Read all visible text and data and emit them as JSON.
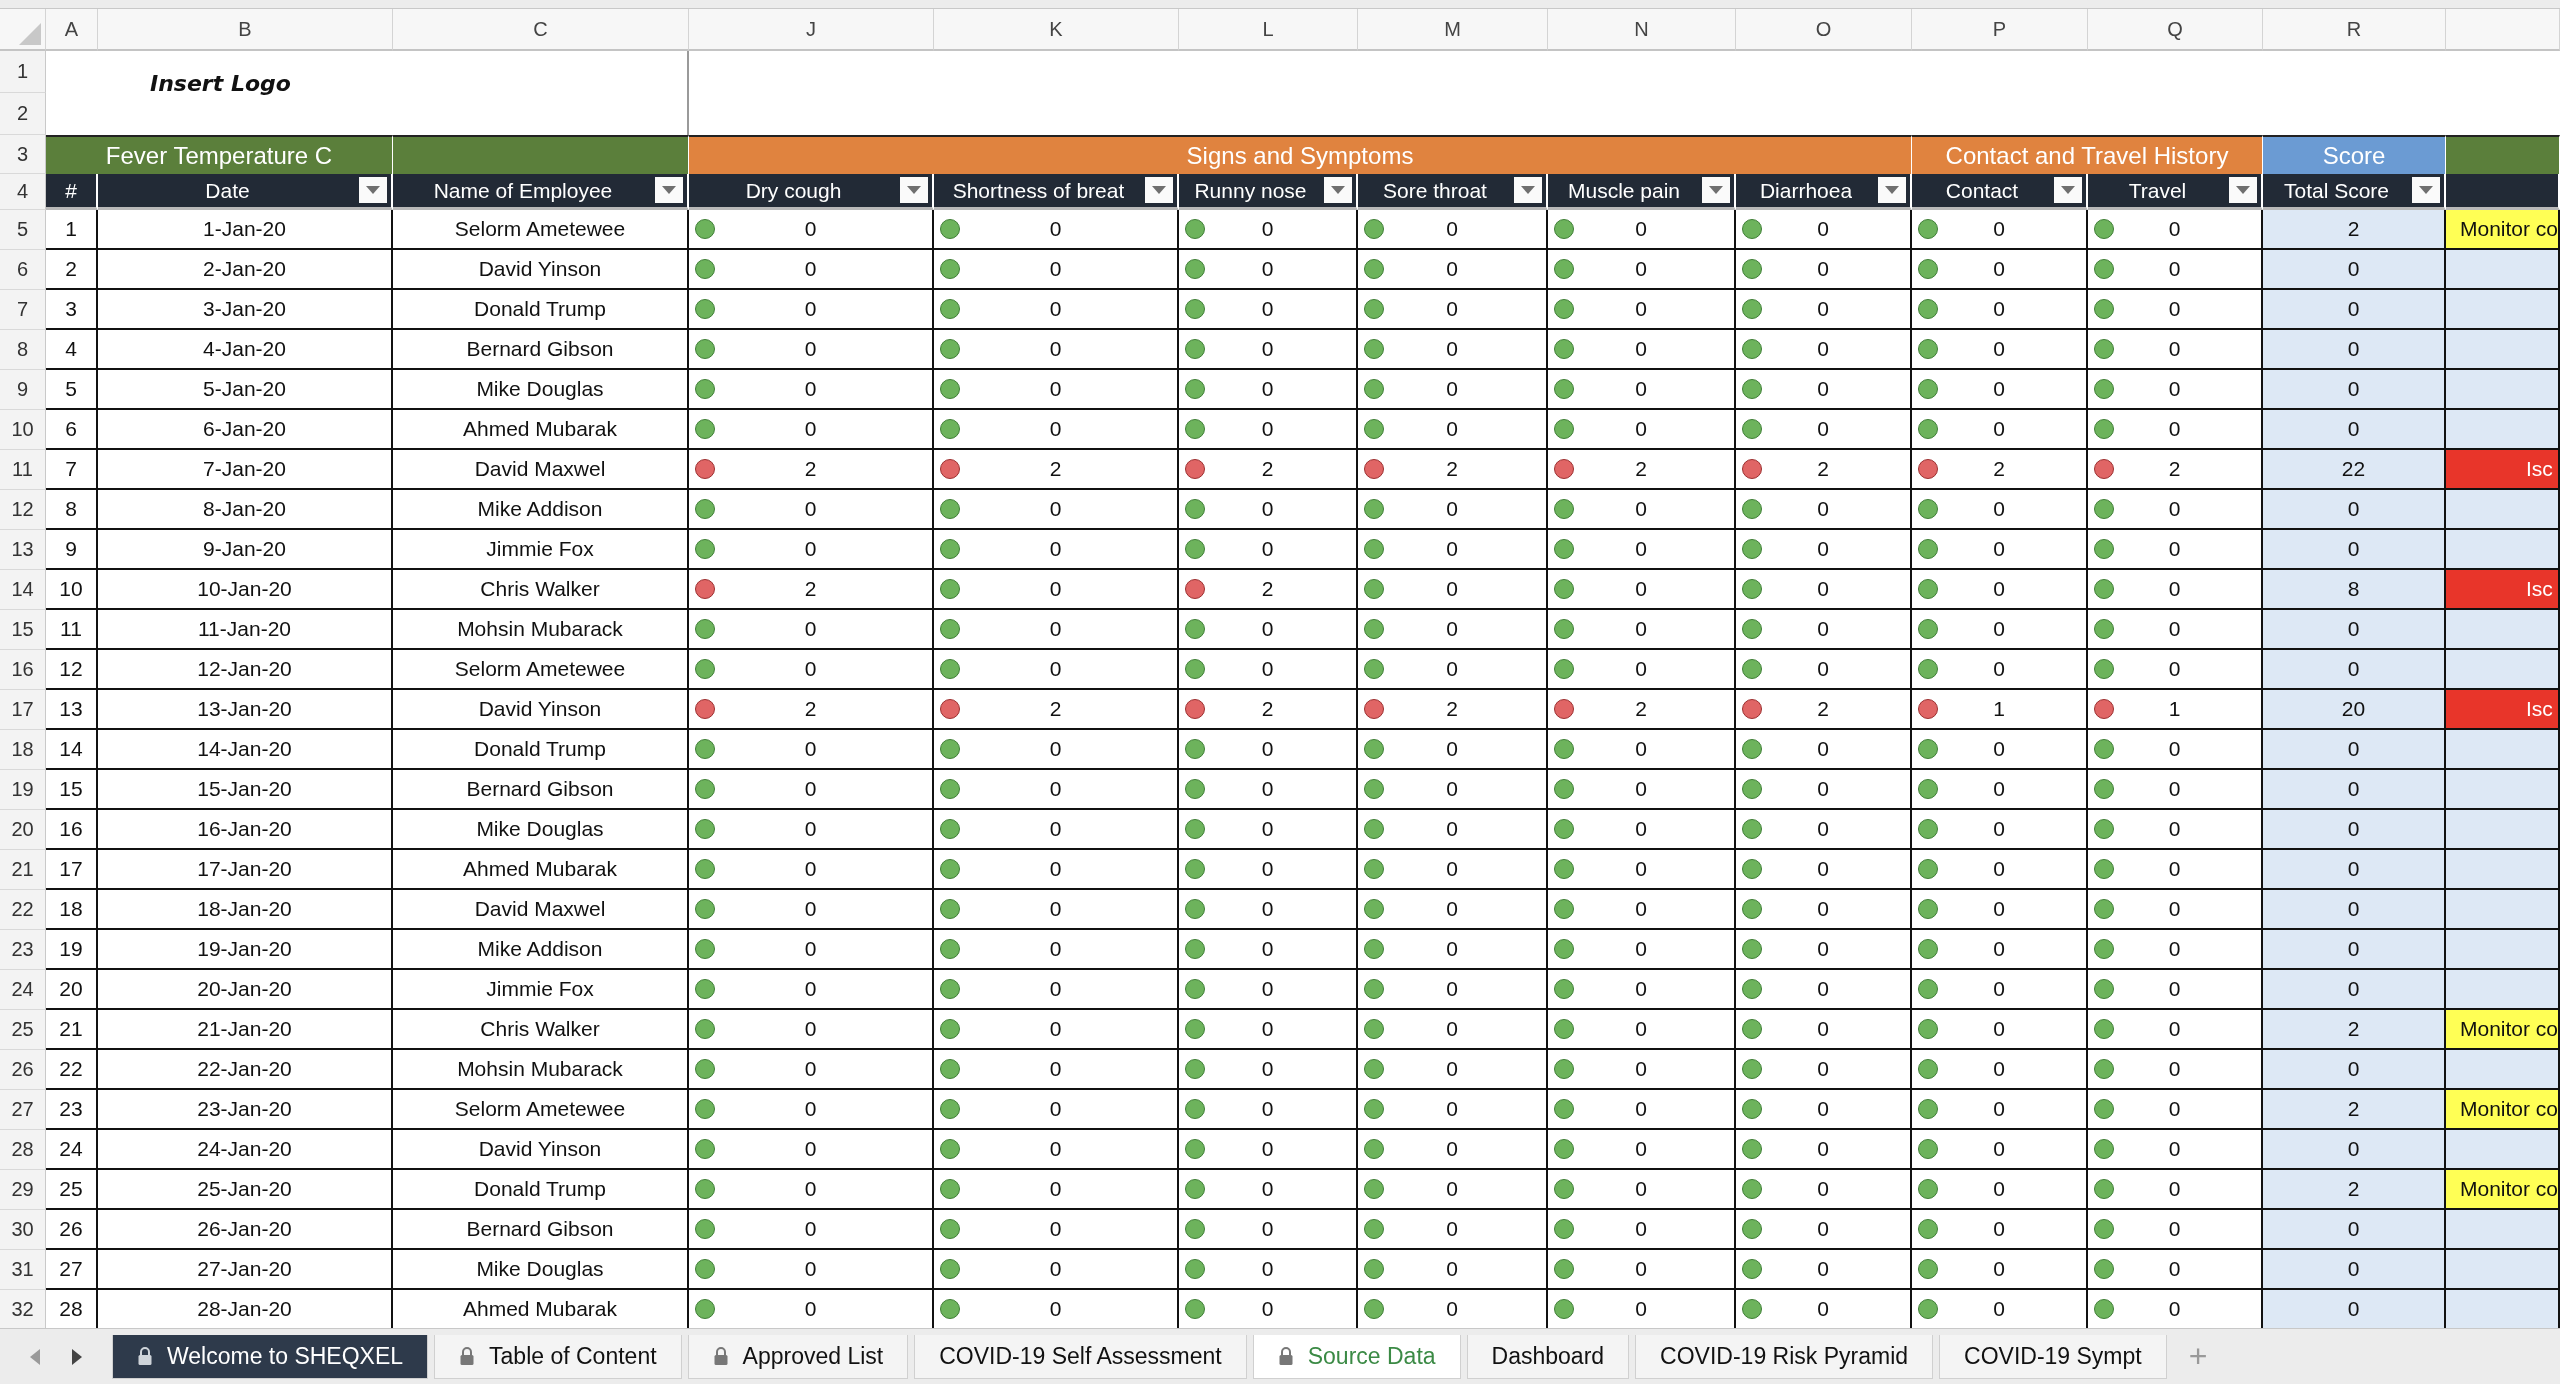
{
  "column_letters": [
    "A",
    "B",
    "C",
    "J",
    "K",
    "L",
    "M",
    "N",
    "O",
    "P",
    "Q",
    "R"
  ],
  "header_row_numbers": [
    "1",
    "2",
    "3",
    "4"
  ],
  "logo_text": "Insert Logo",
  "group_headers": [
    {
      "label": "Fever Temperature C",
      "color": "#5b7f3b"
    },
    {
      "color": "#5b7f3b"
    },
    {
      "label": "Signs and Symptoms",
      "color": "#e0833f"
    },
    {
      "label": "Contact and Travel History",
      "color": "#e0833f"
    },
    {
      "label": "Score",
      "color": "#6b9bd3"
    },
    {
      "color": "#5b7f3b"
    }
  ],
  "columns": [
    {
      "label": "#",
      "filter": false
    },
    {
      "label": "Date",
      "filter": true
    },
    {
      "label": "Name of Employee",
      "filter": true
    },
    {
      "label": "Dry cough",
      "filter": true
    },
    {
      "label": "Shortness of breat",
      "filter": true
    },
    {
      "label": "Runny nose",
      "filter": true
    },
    {
      "label": "Sore throat",
      "filter": true
    },
    {
      "label": "Muscle pain",
      "filter": true
    },
    {
      "label": "Diarrhoea",
      "filter": true
    },
    {
      "label": "Contact",
      "filter": true
    },
    {
      "label": "Travel",
      "filter": true
    },
    {
      "label": "Total Score",
      "filter": true
    }
  ],
  "rows": [
    {
      "row_number": "5",
      "number": "1",
      "date": "1-Jan-20",
      "name": "Selorm Ametewee",
      "symptoms": [
        "0",
        "0",
        "0",
        "0",
        "0",
        "0",
        "0",
        "0"
      ],
      "flags": [
        false,
        false,
        false,
        false,
        false,
        false,
        false,
        false
      ],
      "score": "2",
      "status": {
        "kind": "monitor",
        "text": "Monitor co"
      }
    },
    {
      "row_number": "6",
      "number": "2",
      "date": "2-Jan-20",
      "name": "David Yinson",
      "symptoms": [
        "0",
        "0",
        "0",
        "0",
        "0",
        "0",
        "0",
        "0"
      ],
      "flags": [
        false,
        false,
        false,
        false,
        false,
        false,
        false,
        false
      ],
      "score": "0"
    },
    {
      "row_number": "7",
      "number": "3",
      "date": "3-Jan-20",
      "name": "Donald Trump",
      "symptoms": [
        "0",
        "0",
        "0",
        "0",
        "0",
        "0",
        "0",
        "0"
      ],
      "flags": [
        false,
        false,
        false,
        false,
        false,
        false,
        false,
        false
      ],
      "score": "0"
    },
    {
      "row_number": "8",
      "number": "4",
      "date": "4-Jan-20",
      "name": "Bernard Gibson",
      "symptoms": [
        "0",
        "0",
        "0",
        "0",
        "0",
        "0",
        "0",
        "0"
      ],
      "flags": [
        false,
        false,
        false,
        false,
        false,
        false,
        false,
        false
      ],
      "score": "0"
    },
    {
      "row_number": "9",
      "number": "5",
      "date": "5-Jan-20",
      "name": "Mike Douglas",
      "symptoms": [
        "0",
        "0",
        "0",
        "0",
        "0",
        "0",
        "0",
        "0"
      ],
      "flags": [
        false,
        false,
        false,
        false,
        false,
        false,
        false,
        false
      ],
      "score": "0"
    },
    {
      "row_number": "10",
      "number": "6",
      "date": "6-Jan-20",
      "name": "Ahmed Mubarak",
      "symptoms": [
        "0",
        "0",
        "0",
        "0",
        "0",
        "0",
        "0",
        "0"
      ],
      "flags": [
        false,
        false,
        false,
        false,
        false,
        false,
        false,
        false
      ],
      "score": "0"
    },
    {
      "row_number": "11",
      "number": "7",
      "date": "7-Jan-20",
      "name": "David Maxwel",
      "symptoms": [
        "2",
        "2",
        "2",
        "2",
        "2",
        "2",
        "2",
        "2"
      ],
      "flags": [
        true,
        true,
        true,
        true,
        true,
        true,
        true,
        true
      ],
      "score": "22",
      "status": {
        "kind": "isolate",
        "text": "Isc"
      }
    },
    {
      "row_number": "12",
      "number": "8",
      "date": "8-Jan-20",
      "name": "Mike Addison",
      "symptoms": [
        "0",
        "0",
        "0",
        "0",
        "0",
        "0",
        "0",
        "0"
      ],
      "flags": [
        false,
        false,
        false,
        false,
        false,
        false,
        false,
        false
      ],
      "score": "0"
    },
    {
      "row_number": "13",
      "number": "9",
      "date": "9-Jan-20",
      "name": "Jimmie Fox",
      "symptoms": [
        "0",
        "0",
        "0",
        "0",
        "0",
        "0",
        "0",
        "0"
      ],
      "flags": [
        false,
        false,
        false,
        false,
        false,
        false,
        false,
        false
      ],
      "score": "0"
    },
    {
      "row_number": "14",
      "number": "10",
      "date": "10-Jan-20",
      "name": "Chris Walker",
      "symptoms": [
        "2",
        "0",
        "2",
        "0",
        "0",
        "0",
        "0",
        "0"
      ],
      "flags": [
        true,
        false,
        true,
        false,
        false,
        false,
        false,
        false
      ],
      "score": "8",
      "status": {
        "kind": "isolate",
        "text": "Isc"
      }
    },
    {
      "row_number": "15",
      "number": "11",
      "date": "11-Jan-20",
      "name": "Mohsin Mubarack",
      "symptoms": [
        "0",
        "0",
        "0",
        "0",
        "0",
        "0",
        "0",
        "0"
      ],
      "flags": [
        false,
        false,
        false,
        false,
        false,
        false,
        false,
        false
      ],
      "score": "0"
    },
    {
      "row_number": "16",
      "number": "12",
      "date": "12-Jan-20",
      "name": "Selorm Ametewee",
      "symptoms": [
        "0",
        "0",
        "0",
        "0",
        "0",
        "0",
        "0",
        "0"
      ],
      "flags": [
        false,
        false,
        false,
        false,
        false,
        false,
        false,
        false
      ],
      "score": "0"
    },
    {
      "row_number": "17",
      "number": "13",
      "date": "13-Jan-20",
      "name": "David Yinson",
      "symptoms": [
        "2",
        "2",
        "2",
        "2",
        "2",
        "2",
        "1",
        "1"
      ],
      "flags": [
        true,
        true,
        true,
        true,
        true,
        true,
        true,
        true
      ],
      "score": "20",
      "status": {
        "kind": "isolate",
        "text": "Isc"
      }
    },
    {
      "row_number": "18",
      "number": "14",
      "date": "14-Jan-20",
      "name": "Donald Trump",
      "symptoms": [
        "0",
        "0",
        "0",
        "0",
        "0",
        "0",
        "0",
        "0"
      ],
      "flags": [
        false,
        false,
        false,
        false,
        false,
        false,
        false,
        false
      ],
      "score": "0"
    },
    {
      "row_number": "19",
      "number": "15",
      "date": "15-Jan-20",
      "name": "Bernard Gibson",
      "symptoms": [
        "0",
        "0",
        "0",
        "0",
        "0",
        "0",
        "0",
        "0"
      ],
      "flags": [
        false,
        false,
        false,
        false,
        false,
        false,
        false,
        false
      ],
      "score": "0"
    },
    {
      "row_number": "20",
      "number": "16",
      "date": "16-Jan-20",
      "name": "Mike Douglas",
      "symptoms": [
        "0",
        "0",
        "0",
        "0",
        "0",
        "0",
        "0",
        "0"
      ],
      "flags": [
        false,
        false,
        false,
        false,
        false,
        false,
        false,
        false
      ],
      "score": "0"
    },
    {
      "row_number": "21",
      "number": "17",
      "date": "17-Jan-20",
      "name": "Ahmed Mubarak",
      "symptoms": [
        "0",
        "0",
        "0",
        "0",
        "0",
        "0",
        "0",
        "0"
      ],
      "flags": [
        false,
        false,
        false,
        false,
        false,
        false,
        false,
        false
      ],
      "score": "0"
    },
    {
      "row_number": "22",
      "number": "18",
      "date": "18-Jan-20",
      "name": "David Maxwel",
      "symptoms": [
        "0",
        "0",
        "0",
        "0",
        "0",
        "0",
        "0",
        "0"
      ],
      "flags": [
        false,
        false,
        false,
        false,
        false,
        false,
        false,
        false
      ],
      "score": "0"
    },
    {
      "row_number": "23",
      "number": "19",
      "date": "19-Jan-20",
      "name": "Mike Addison",
      "symptoms": [
        "0",
        "0",
        "0",
        "0",
        "0",
        "0",
        "0",
        "0"
      ],
      "flags": [
        false,
        false,
        false,
        false,
        false,
        false,
        false,
        false
      ],
      "score": "0"
    },
    {
      "row_number": "24",
      "number": "20",
      "date": "20-Jan-20",
      "name": "Jimmie Fox",
      "symptoms": [
        "0",
        "0",
        "0",
        "0",
        "0",
        "0",
        "0",
        "0"
      ],
      "flags": [
        false,
        false,
        false,
        false,
        false,
        false,
        false,
        false
      ],
      "score": "0"
    },
    {
      "row_number": "25",
      "number": "21",
      "date": "21-Jan-20",
      "name": "Chris Walker",
      "symptoms": [
        "0",
        "0",
        "0",
        "0",
        "0",
        "0",
        "0",
        "0"
      ],
      "flags": [
        false,
        false,
        false,
        false,
        false,
        false,
        false,
        false
      ],
      "score": "2",
      "status": {
        "kind": "monitor",
        "text": "Monitor co"
      }
    },
    {
      "row_number": "26",
      "number": "22",
      "date": "22-Jan-20",
      "name": "Mohsin Mubarack",
      "symptoms": [
        "0",
        "0",
        "0",
        "0",
        "0",
        "0",
        "0",
        "0"
      ],
      "flags": [
        false,
        false,
        false,
        false,
        false,
        false,
        false,
        false
      ],
      "score": "0"
    },
    {
      "row_number": "27",
      "number": "23",
      "date": "23-Jan-20",
      "name": "Selorm Ametewee",
      "symptoms": [
        "0",
        "0",
        "0",
        "0",
        "0",
        "0",
        "0",
        "0"
      ],
      "flags": [
        false,
        false,
        false,
        false,
        false,
        false,
        false,
        false
      ],
      "score": "2",
      "status": {
        "kind": "monitor",
        "text": "Monitor co"
      }
    },
    {
      "row_number": "28",
      "number": "24",
      "date": "24-Jan-20",
      "name": "David Yinson",
      "symptoms": [
        "0",
        "0",
        "0",
        "0",
        "0",
        "0",
        "0",
        "0"
      ],
      "flags": [
        false,
        false,
        false,
        false,
        false,
        false,
        false,
        false
      ],
      "score": "0"
    },
    {
      "row_number": "29",
      "number": "25",
      "date": "25-Jan-20",
      "name": "Donald Trump",
      "symptoms": [
        "0",
        "0",
        "0",
        "0",
        "0",
        "0",
        "0",
        "0"
      ],
      "flags": [
        false,
        false,
        false,
        false,
        false,
        false,
        false,
        false
      ],
      "score": "2",
      "status": {
        "kind": "monitor",
        "text": "Monitor co"
      }
    },
    {
      "row_number": "30",
      "number": "26",
      "date": "26-Jan-20",
      "name": "Bernard Gibson",
      "symptoms": [
        "0",
        "0",
        "0",
        "0",
        "0",
        "0",
        "0",
        "0"
      ],
      "flags": [
        false,
        false,
        false,
        false,
        false,
        false,
        false,
        false
      ],
      "score": "0"
    },
    {
      "row_number": "31",
      "number": "27",
      "date": "27-Jan-20",
      "name": "Mike Douglas",
      "symptoms": [
        "0",
        "0",
        "0",
        "0",
        "0",
        "0",
        "0",
        "0"
      ],
      "flags": [
        false,
        false,
        false,
        false,
        false,
        false,
        false,
        false
      ],
      "score": "0"
    },
    {
      "row_number": "32",
      "number": "28",
      "date": "28-Jan-20",
      "name": "Ahmed Mubarak",
      "symptoms": [
        "0",
        "0",
        "0",
        "0",
        "0",
        "0",
        "0",
        "0"
      ],
      "flags": [
        false,
        false,
        false,
        false,
        false,
        false,
        false,
        false
      ],
      "score": "0"
    }
  ],
  "sheet_tabs": [
    {
      "label": "Welcome to SHEQXEL",
      "selected": false,
      "locked": true,
      "color": "#2e3a4b"
    },
    {
      "label": "Table of Content",
      "selected": false,
      "locked": true
    },
    {
      "label": "Approved List",
      "selected": false,
      "locked": true
    },
    {
      "label": "COVID-19 Self Assessment",
      "selected": false,
      "locked": false
    },
    {
      "label": "Source Data",
      "selected": true,
      "locked": true
    },
    {
      "label": "Dashboard",
      "selected": false,
      "locked": false
    },
    {
      "label": "COVID-19 Risk Pyramid",
      "selected": false,
      "locked": false
    },
    {
      "label": "COVID-19 Sympt",
      "selected": false,
      "locked": false
    }
  ],
  "add_tab": "+"
}
